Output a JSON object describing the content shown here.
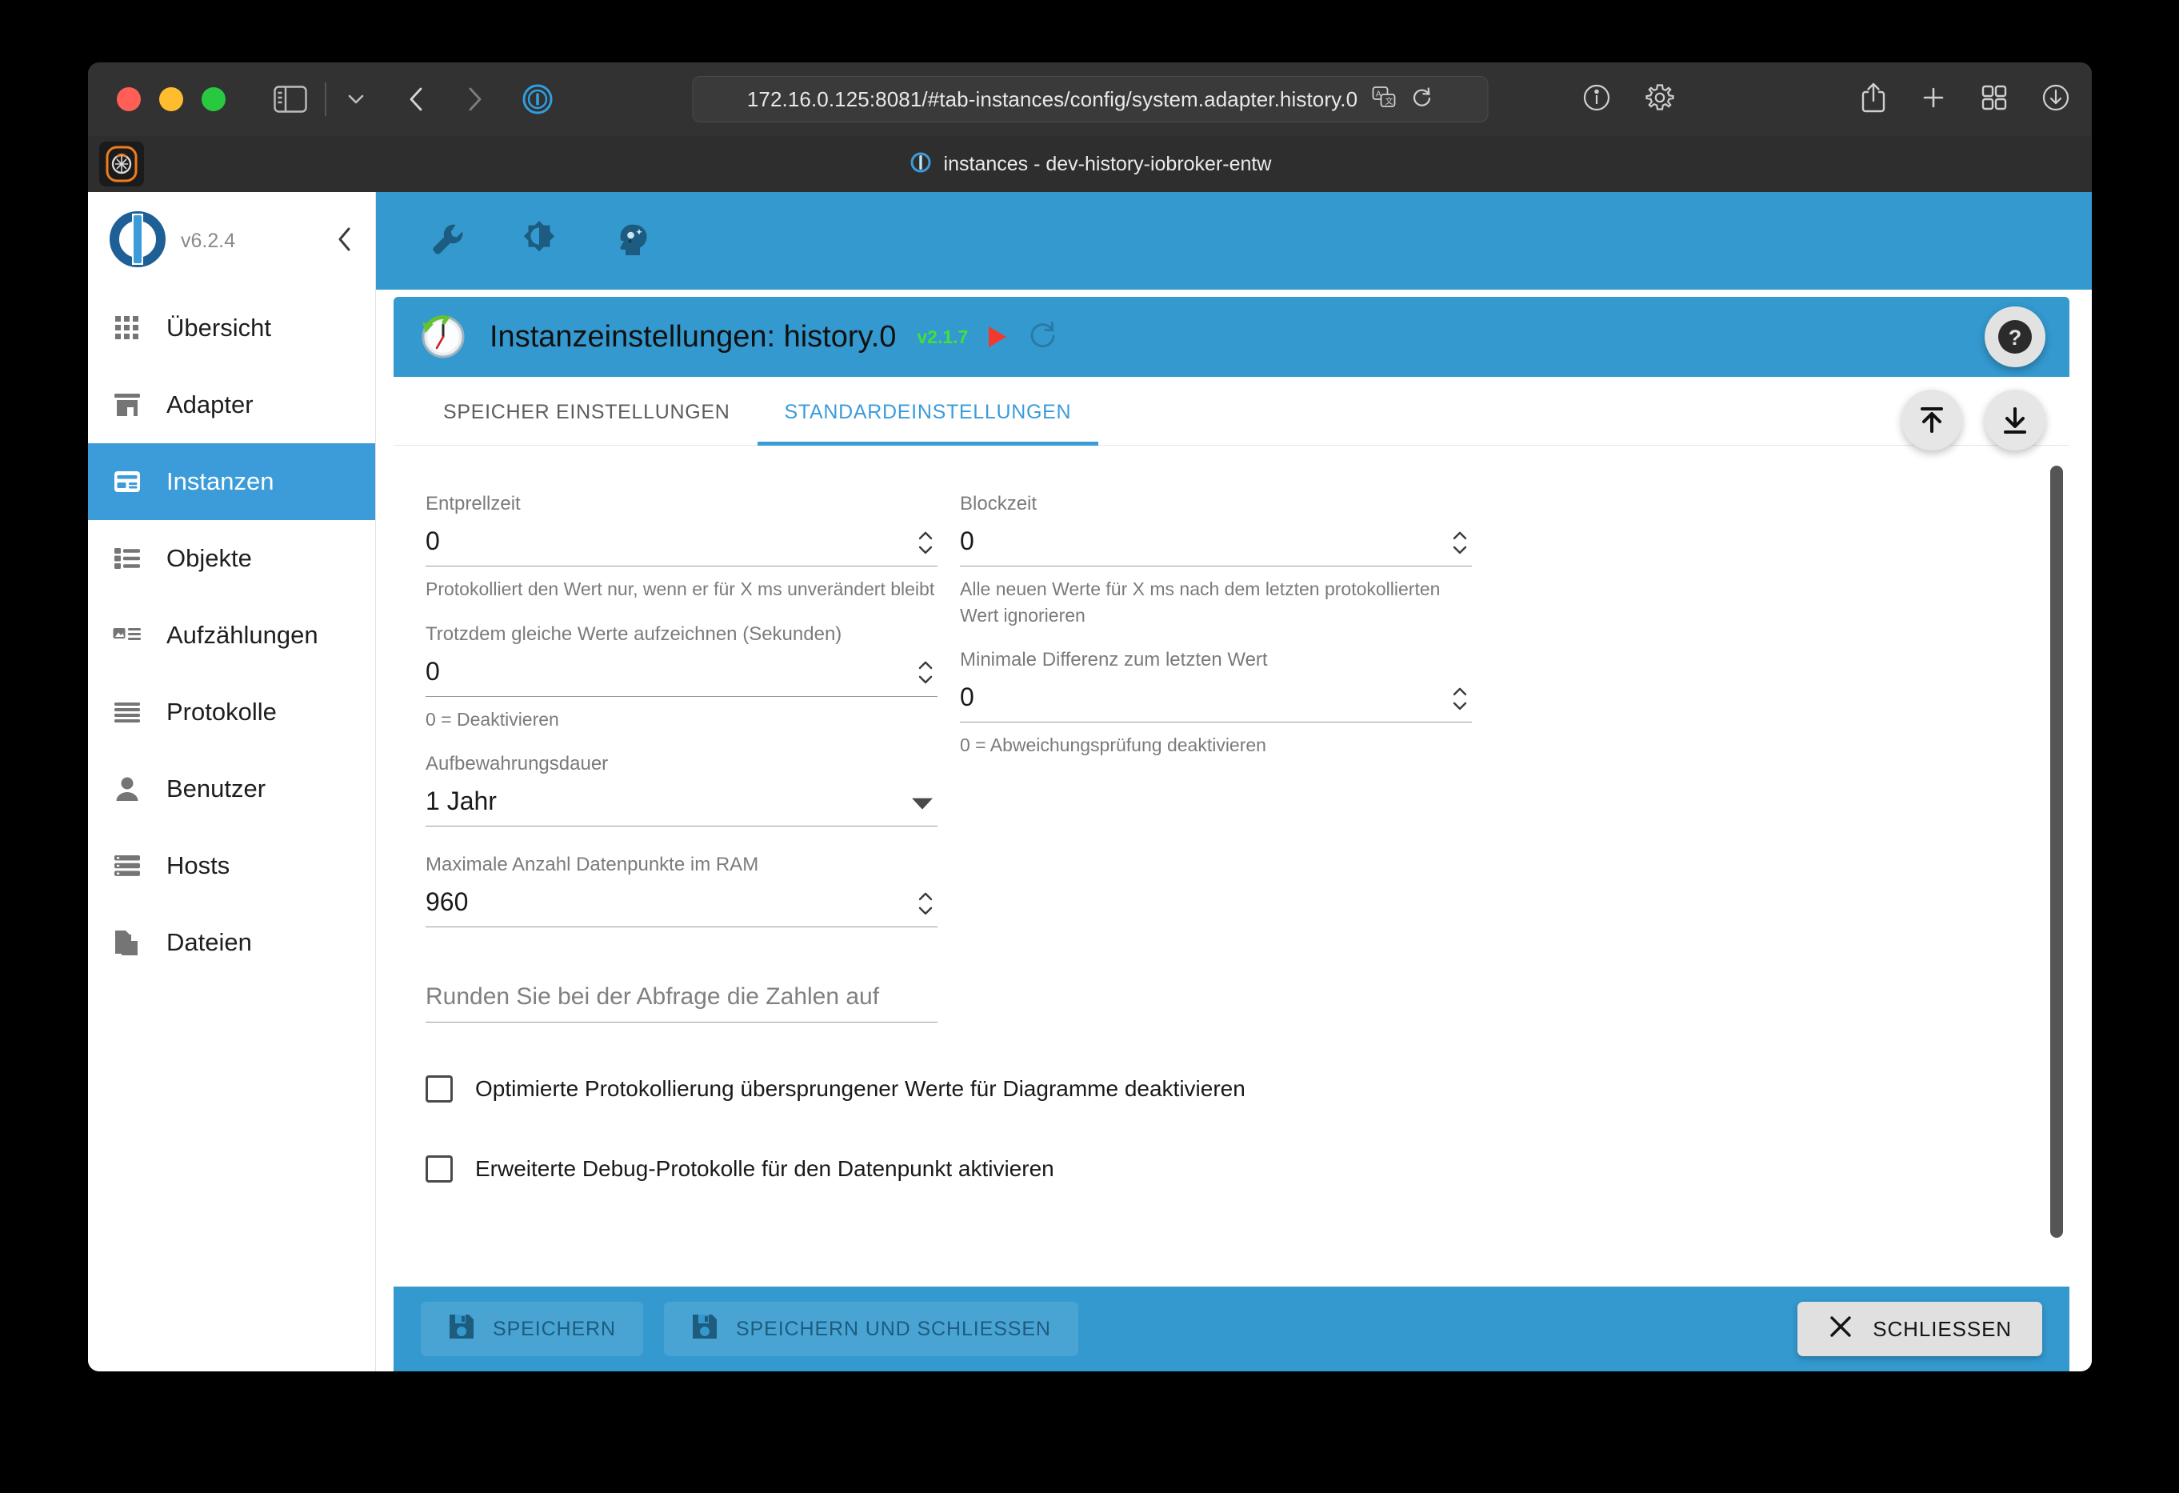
{
  "browser": {
    "url": "172.16.0.125:8081/#tab-instances/config/system.adapter.history.0",
    "tab_title": "instances - dev-history-iobroker-entw",
    "window_controls": [
      "close",
      "minimize",
      "maximize"
    ],
    "left_icons": [
      "sidebar-toggle-icon",
      "chevron-down-icon",
      "back-arrow-icon",
      "forward-arrow-icon",
      "password-manager-icon"
    ],
    "url_icons": [
      "translate-icon",
      "reload-icon"
    ],
    "right_icons": [
      "info-icon",
      "gear-icon",
      "share-icon",
      "plus-icon",
      "tab-overview-icon",
      "downloads-icon"
    ]
  },
  "sidebar": {
    "version": "v6.2.4",
    "collapse_label": "collapse",
    "items": [
      {
        "label": "Übersicht",
        "icon": "grid-icon",
        "active": false
      },
      {
        "label": "Adapter",
        "icon": "store-icon",
        "active": false
      },
      {
        "label": "Instanzen",
        "icon": "instances-icon",
        "active": true
      },
      {
        "label": "Objekte",
        "icon": "list-icon",
        "active": false
      },
      {
        "label": "Aufzählungen",
        "icon": "enum-icon",
        "active": false
      },
      {
        "label": "Protokolle",
        "icon": "log-icon",
        "active": false
      },
      {
        "label": "Benutzer",
        "icon": "user-icon",
        "active": false
      },
      {
        "label": "Hosts",
        "icon": "hosts-icon",
        "active": false
      },
      {
        "label": "Dateien",
        "icon": "files-icon",
        "active": false
      }
    ]
  },
  "app_bar": {
    "icons": [
      "wrench-icon",
      "brightness-icon",
      "ai-assistant-icon"
    ]
  },
  "card": {
    "title": "Instanzeinstellungen: history.0",
    "version": "v2.1.7",
    "adapter_icon": "clock-history-icon",
    "start_icon": "play-icon",
    "refresh_icon": "refresh-icon",
    "help_icon": "question-mark-icon",
    "fabs": [
      {
        "name": "export-settings",
        "icon": "upload-icon"
      },
      {
        "name": "import-settings",
        "icon": "download-icon"
      }
    ],
    "tabs": [
      {
        "label": "SPEICHER EINSTELLUNGEN",
        "active": false
      },
      {
        "label": "STANDARDEINSTELLUNGEN",
        "active": true
      }
    ]
  },
  "form": {
    "left": [
      {
        "label": "Entprellzeit",
        "value": "0",
        "help": "Protokolliert den Wert nur, wenn er für X ms unverändert bleibt",
        "control": "number"
      },
      {
        "label": "Trotzdem gleiche Werte aufzeichnen (Sekunden)",
        "value": "0",
        "help": "0 = Deaktivieren",
        "control": "number"
      },
      {
        "label": "Aufbewahrungsdauer",
        "value": "1 Jahr",
        "help": "",
        "control": "select"
      },
      {
        "label": "Maximale Anzahl Datenpunkte im RAM",
        "value": "960",
        "help": "",
        "control": "number"
      }
    ],
    "right": [
      {
        "label": "Blockzeit",
        "value": "0",
        "help": "Alle neuen Werte für X ms nach dem letzten protokollierten Wert ignorieren",
        "control": "number"
      },
      {
        "label": "Minimale Differenz zum letzten Wert",
        "value": "0",
        "help": "0 = Abweichungsprüfung deaktivieren",
        "control": "number"
      }
    ],
    "round_field": {
      "placeholder": "Runden Sie bei der Abfrage die Zahlen auf",
      "value": ""
    },
    "checkboxes": [
      {
        "label": "Optimierte Protokollierung übersprungener Werte für Diagramme deaktivieren",
        "checked": false
      },
      {
        "label": "Erweiterte Debug-Protokolle für den Datenpunkt aktivieren",
        "checked": false
      }
    ]
  },
  "bottom_bar": {
    "save": {
      "label": "SPEICHERN",
      "icon": "save-icon",
      "disabled": true
    },
    "save_close": {
      "label": "SPEICHERN UND SCHLIESSEN",
      "icon": "save-icon",
      "disabled": true
    },
    "close": {
      "label": "SCHLIESSEN",
      "icon": "close-x-icon"
    }
  },
  "colors": {
    "accent": "#3399cf",
    "sidebar_active": "#3b9cd9",
    "version_green": "#41e03a",
    "play_red": "#f2392e"
  }
}
